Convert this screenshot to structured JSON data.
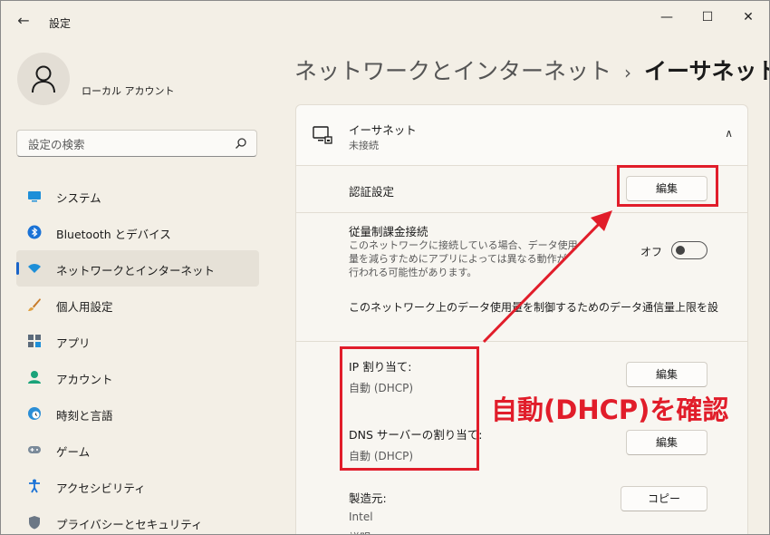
{
  "window": {
    "title": "設定",
    "back_glyph": "←",
    "minimize_glyph": "—",
    "maximize_glyph": "☐",
    "close_glyph": "✕"
  },
  "user": {
    "name": "ローカル アカウント"
  },
  "search": {
    "placeholder": "設定の検索"
  },
  "sidebar": {
    "items": [
      {
        "label": "システム",
        "icon": "system-icon"
      },
      {
        "label": "Bluetooth とデバイス",
        "icon": "bluetooth-icon"
      },
      {
        "label": "ネットワークとインターネット",
        "icon": "network-icon",
        "active": true
      },
      {
        "label": "個人用設定",
        "icon": "brush-icon"
      },
      {
        "label": "アプリ",
        "icon": "apps-icon"
      },
      {
        "label": "アカウント",
        "icon": "account-icon"
      },
      {
        "label": "時刻と言語",
        "icon": "clock-globe-icon"
      },
      {
        "label": "ゲーム",
        "icon": "gamepad-icon"
      },
      {
        "label": "アクセシビリティ",
        "icon": "accessibility-icon"
      },
      {
        "label": "プライバシーとセキュリティ",
        "icon": "shield-icon"
      }
    ]
  },
  "breadcrumb": {
    "parent": "ネットワークとインターネット",
    "separator": "›",
    "current": "イーサネット"
  },
  "ethernet": {
    "title": "イーサネット",
    "status": "未接続"
  },
  "auth": {
    "label": "認証設定",
    "button": "編集"
  },
  "metered": {
    "label": "従量制課金接続",
    "desc_1": "このネットワークに接続している場合、データ使用",
    "desc_2": "量を減らすためにアプリによっては異なる動作が",
    "desc_3": "行われる可能性があります。",
    "state": "オフ",
    "on": false
  },
  "data_limit": {
    "text": "このネットワーク上のデータ使用量を制御するためのデータ通信量上限を設"
  },
  "ip": {
    "label": "IP 割り当て:",
    "value": "自動 (DHCP)",
    "button": "編集"
  },
  "dns": {
    "label": "DNS サーバーの割り当て:",
    "value": "自動 (DHCP)",
    "button": "編集"
  },
  "manufacturer": {
    "label": "製造元:",
    "value": "Intel",
    "button": "コピー",
    "next_label_partial": "説明"
  },
  "annotation": {
    "text": "自動(DHCP)を確認",
    "color": "#e11d2a"
  },
  "colors": {
    "accent": "#1a64c8",
    "annotation": "#e11d2a",
    "background": "#f3efe6"
  }
}
